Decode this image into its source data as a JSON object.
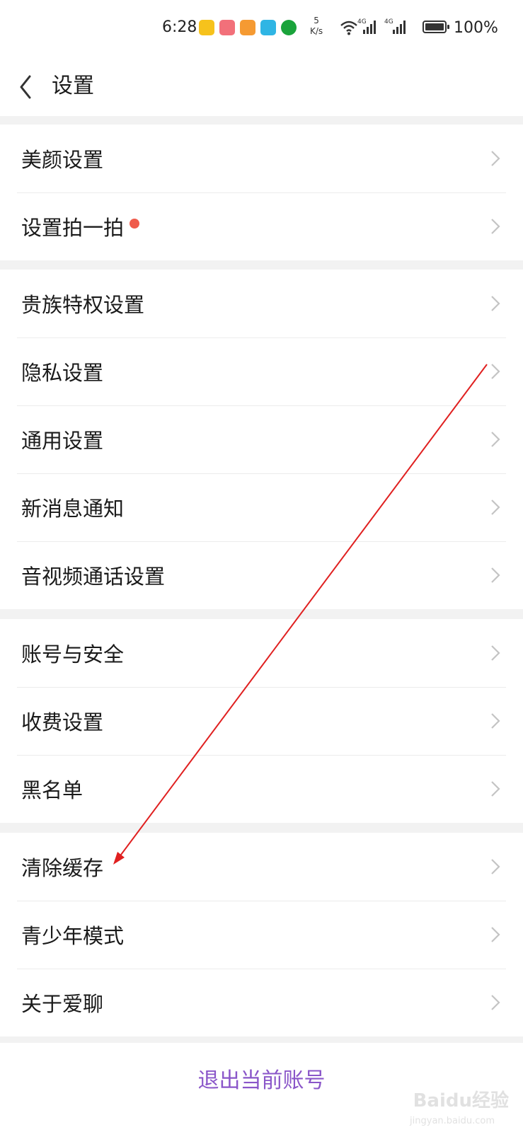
{
  "status_bar": {
    "time": "6:28",
    "net_speed_value": "5",
    "net_speed_unit": "K/s",
    "signal_label_1": "4G",
    "signal_label_2": "4G",
    "battery_percent": "100%",
    "app_icons": [
      "app-7-icon",
      "app-bag-icon",
      "app-play-icon",
      "app-book-icon",
      "app-circle-icon"
    ],
    "app_colors": [
      "#f6c21c",
      "#f2707a",
      "#f59a32",
      "#2fb5e4",
      "#1aa33b"
    ]
  },
  "header": {
    "title": "设置"
  },
  "groups": [
    {
      "items": [
        {
          "label": "美颜设置"
        },
        {
          "label": "设置拍一拍",
          "badge": "red-dot"
        }
      ]
    },
    {
      "items": [
        {
          "label": "贵族特权设置"
        },
        {
          "label": "隐私设置"
        },
        {
          "label": "通用设置"
        },
        {
          "label": "新消息通知"
        },
        {
          "label": "音视频通话设置"
        }
      ]
    },
    {
      "items": [
        {
          "label": "账号与安全"
        },
        {
          "label": "收费设置"
        },
        {
          "label": "黑名单"
        }
      ]
    },
    {
      "items": [
        {
          "label": "清除缓存"
        },
        {
          "label": "青少年模式"
        },
        {
          "label": "关于爱聊"
        }
      ]
    }
  ],
  "logout": {
    "label": "退出当前账号"
  },
  "watermark": {
    "text": "Baidu经验",
    "sub": "jingyan.baidu.com"
  },
  "colors": {
    "accent": "#8a56c9",
    "badge": "#ef5b4b",
    "annotation_arrow": "#e02020"
  }
}
